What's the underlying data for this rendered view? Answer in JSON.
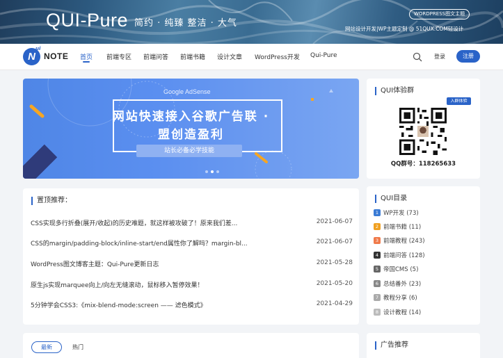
{
  "banner": {
    "title": "QUI-Pure",
    "slogan": "简约 · 纯臻   整洁 · 大气",
    "badge": "WORDPRESS图文主题",
    "credit": "网站设计开发|WP主题定制 @ 51QUX.COM轻设计"
  },
  "nav": {
    "logo_letter": "N",
    "logo_sup": "ui",
    "logo_text": "NOTE",
    "items": [
      "首页",
      "前端专区",
      "前端问答",
      "前端书籍",
      "设计文章",
      "WordPress开发",
      "Qui-Pure"
    ],
    "login": "登录",
    "register": "注册",
    "icons": {
      "search": "search-icon"
    },
    "accent": "#2a63c8"
  },
  "hero": {
    "subtitle": "Google AdSense",
    "line1": "网站快速接入谷歌广告联 ·",
    "line2": "盟创造盈利",
    "tag": "站长必备必学技能",
    "slides": 3,
    "active_slide": 1
  },
  "pinned": {
    "heading": "置顶推荐：",
    "rows": [
      {
        "title": "CSS实现多行折叠(展开/收起)的历史难题，就这样被攻破了！原来我们差...",
        "date": "2021-06-07"
      },
      {
        "title": "CSS的margin/padding-block/inline-start/end属性你了解吗？margin-bl...",
        "date": "2021-06-07"
      },
      {
        "title": "WordPress图文博客主题：Qui-Pure更新日志",
        "date": "2021-05-28"
      },
      {
        "title": "原生js实现marquee向上/向左无缝滚动，鼠标移入暂停效果！",
        "date": "2021-05-20"
      },
      {
        "title": "5分钟学会CSS3:《mix-blend-mode:screen —— 滤色模式》",
        "date": "2021-04-29"
      }
    ]
  },
  "tabs": {
    "latest": "最新",
    "hot": "热门"
  },
  "qr": {
    "heading": "QUI体验群",
    "badge": "入群体验",
    "caption": "QQ群号：118265633"
  },
  "categories": {
    "heading": "QUI目录",
    "items": [
      {
        "num": "1",
        "label": "WP开发 (73)",
        "color": "#3a7bd5"
      },
      {
        "num": "2",
        "label": "前端书籍 (11)",
        "color": "#f0a020"
      },
      {
        "num": "3",
        "label": "前端教程 (243)",
        "color": "#f07a4a"
      },
      {
        "num": "4",
        "label": "前端问答 (128)",
        "color": "#333333"
      },
      {
        "num": "5",
        "label": "帝国CMS (5)",
        "color": "#666666"
      },
      {
        "num": "6",
        "label": "总结番外 (23)",
        "color": "#888888"
      },
      {
        "num": "7",
        "label": "教程分享 (6)",
        "color": "#aaaaaa"
      },
      {
        "num": "8",
        "label": "设计教程 (14)",
        "color": "#bbbbbb"
      }
    ]
  },
  "ad": {
    "heading": "广告推荐"
  }
}
